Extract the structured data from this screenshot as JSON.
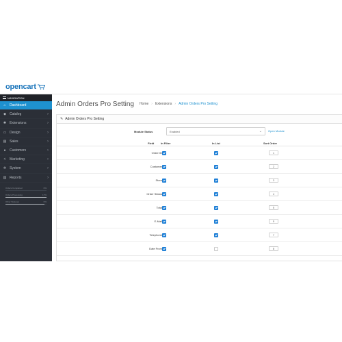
{
  "logo": {
    "text": "opencart"
  },
  "sidebar": {
    "header": "NAVIGATION",
    "items": [
      {
        "label": "Dashboard",
        "icon": "home-icon",
        "glyph": "⌂",
        "active": true,
        "chevron": false
      },
      {
        "label": "Catalog",
        "icon": "tag-icon",
        "glyph": "◆",
        "active": false,
        "chevron": true
      },
      {
        "label": "Extensions",
        "icon": "puzzle-icon",
        "glyph": "✱",
        "active": false,
        "chevron": true
      },
      {
        "label": "Design",
        "icon": "monitor-icon",
        "glyph": "▭",
        "active": false,
        "chevron": true
      },
      {
        "label": "Sales",
        "icon": "cart-icon",
        "glyph": "▤",
        "active": false,
        "chevron": true
      },
      {
        "label": "Customers",
        "icon": "user-icon",
        "glyph": "●",
        "active": false,
        "chevron": true
      },
      {
        "label": "Marketing",
        "icon": "share-icon",
        "glyph": "<",
        "active": false,
        "chevron": true
      },
      {
        "label": "System",
        "icon": "gear-icon",
        "glyph": "✲",
        "active": false,
        "chevron": true
      },
      {
        "label": "Reports",
        "icon": "chart-icon",
        "glyph": "▥",
        "active": false,
        "chevron": true
      }
    ],
    "progress": [
      {
        "label": "Orders Completed",
        "value": "0%",
        "fraction": 0.0
      },
      {
        "label": "Orders Processing",
        "value": "17%",
        "fraction": 1.0
      },
      {
        "label": "Other Statuses",
        "value": "0%",
        "fraction": 0.95
      }
    ]
  },
  "page": {
    "title": "Admin Orders Pro Setting",
    "breadcrumb": [
      "Home",
      "Extensions",
      "Admin Orders Pro Setting"
    ]
  },
  "panel": {
    "title": "Admin Orders Pro Setting",
    "module_status_label": "Module Status",
    "module_status_value": "Enabled",
    "open_module_label": "Open Module"
  },
  "table": {
    "headers": {
      "field": "Field",
      "in_filter": "In Filter",
      "in_list": "In List",
      "sort_order": "Sort Order"
    },
    "rows": [
      {
        "field": "Order ID",
        "in_filter": true,
        "in_list": true,
        "sort": "1"
      },
      {
        "field": "Customer",
        "in_filter": true,
        "in_list": true,
        "sort": "2"
      },
      {
        "field": "Store",
        "in_filter": true,
        "in_list": true,
        "sort": "3"
      },
      {
        "field": "Order Status",
        "in_filter": true,
        "in_list": true,
        "sort": "4"
      },
      {
        "field": "Total",
        "in_filter": true,
        "in_list": true,
        "sort": "5"
      },
      {
        "field": "E-Mail",
        "in_filter": true,
        "in_list": true,
        "sort": "5"
      },
      {
        "field": "Telephone",
        "in_filter": true,
        "in_list": true,
        "sort": "7"
      },
      {
        "field": "Date From",
        "in_filter": true,
        "in_list": false,
        "sort": "8"
      }
    ]
  },
  "colors": {
    "accent": "#1e91cf",
    "sidebar": "#2b2f37",
    "checkbox": "#1e7fd6",
    "logo": "#1b75bb"
  }
}
